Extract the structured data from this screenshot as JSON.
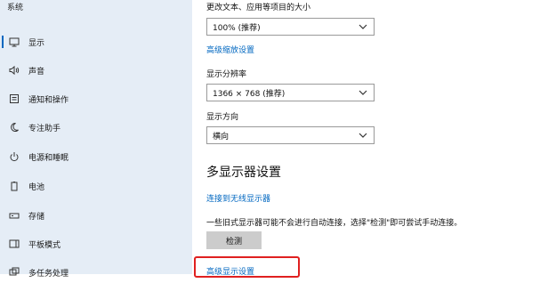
{
  "sidebar": {
    "title": "系统",
    "items": [
      {
        "label": "显示",
        "icon": "monitor-icon",
        "active": true
      },
      {
        "label": "声音",
        "icon": "speaker-icon"
      },
      {
        "label": "通知和操作",
        "icon": "notification-icon"
      },
      {
        "label": "专注助手",
        "icon": "moon-icon"
      },
      {
        "label": "电源和睡眠",
        "icon": "power-icon"
      },
      {
        "label": "电池",
        "icon": "battery-icon"
      },
      {
        "label": "存储",
        "icon": "storage-icon"
      },
      {
        "label": "平板模式",
        "icon": "tablet-icon"
      },
      {
        "label": "多任务处理",
        "icon": "multitask-icon"
      }
    ]
  },
  "main": {
    "scale_label": "更改文本、应用等项目的大小",
    "scale_value": "100% (推荐)",
    "advanced_scaling_link": "高级缩放设置",
    "resolution_label": "显示分辨率",
    "resolution_value": "1366 × 768 (推荐)",
    "orientation_label": "显示方向",
    "orientation_value": "横向",
    "multi_display_heading": "多显示器设置",
    "wireless_link": "连接到无线显示器",
    "detect_note": "一些旧式显示器可能不会进行自动连接，选择\"检测\"即可尝试手动连接。",
    "detect_button": "检测",
    "advanced_display_link": "高级显示设置"
  },
  "colors": {
    "accent": "#0067c0",
    "sidebar_bg": "#e5edf6",
    "highlight": "#e02020"
  }
}
